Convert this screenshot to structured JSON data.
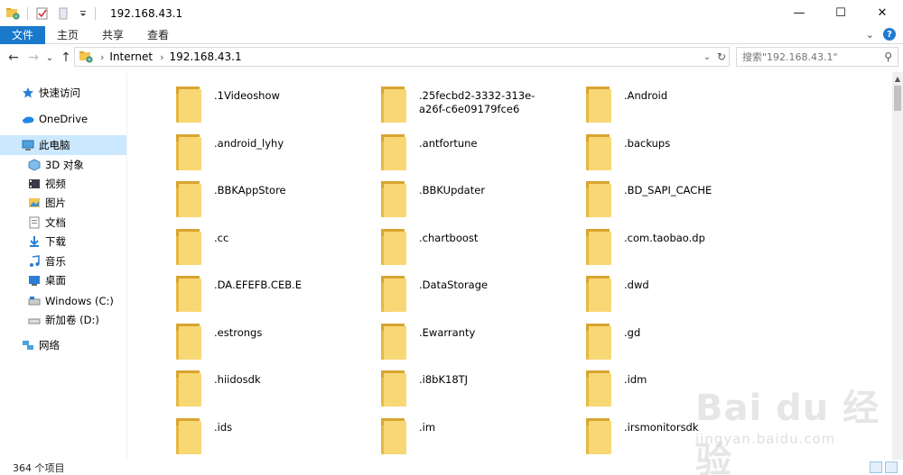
{
  "window": {
    "title": "192.168.43.1",
    "minimize": "—",
    "maximize": "☐",
    "close": "✕"
  },
  "ribbon": {
    "tabs": [
      "文件",
      "主页",
      "共享",
      "查看"
    ],
    "collapse_glyph": "⌄",
    "help_glyph": "?"
  },
  "nav": {
    "back_glyph": "←",
    "forward_glyph": "→",
    "recent_glyph": "⌄",
    "up_glyph": "↑",
    "crumbs": [
      "Internet",
      "192.168.43.1"
    ],
    "crumb_sep": "›",
    "addr_dropdown": "⌄",
    "refresh_glyph": "↻",
    "search_placeholder": "搜索\"192.168.43.1\"",
    "search_glyph": "⚲"
  },
  "sidebar": {
    "items": [
      {
        "label": "快速访问",
        "icon": "star-icon"
      },
      {
        "label": "OneDrive",
        "icon": "cloud-icon"
      },
      {
        "label": "此电脑",
        "icon": "computer-icon"
      },
      {
        "label": "3D 对象",
        "icon": "cube-icon"
      },
      {
        "label": "视频",
        "icon": "video-icon"
      },
      {
        "label": "图片",
        "icon": "image-icon"
      },
      {
        "label": "文档",
        "icon": "document-icon"
      },
      {
        "label": "下载",
        "icon": "download-icon"
      },
      {
        "label": "音乐",
        "icon": "music-icon"
      },
      {
        "label": "桌面",
        "icon": "desktop-icon"
      },
      {
        "label": "Windows (C:)",
        "icon": "drive-icon"
      },
      {
        "label": "新加卷 (D:)",
        "icon": "drive-icon"
      },
      {
        "label": "网络",
        "icon": "network-icon"
      }
    ]
  },
  "files": [
    ".1Videoshow",
    ".25fecbd2-3332-313e-a26f-c6e09179fce6",
    ".Android",
    ".android_lyhy",
    ".antfortune",
    ".backups",
    ".BBKAppStore",
    ".BBKUpdater",
    ".BD_SAPI_CACHE",
    ".cc",
    ".chartboost",
    ".com.taobao.dp",
    ".DA.EFEFB.CEB.E",
    ".DataStorage",
    ".dwd",
    ".estrongs",
    ".Ewarranty",
    ".gd",
    ".hiidosdk",
    ".i8bK18TJ",
    ".idm",
    ".ids",
    ".im",
    ".irsmonitorsdk"
  ],
  "status": {
    "item_count": "364 个项目"
  },
  "watermark": {
    "brand": "Bai du 经验",
    "url": "jingyan.baidu.com"
  },
  "colors": {
    "accent": "#1979ca",
    "folder": "#f8d775",
    "selection": "#cce8ff"
  }
}
